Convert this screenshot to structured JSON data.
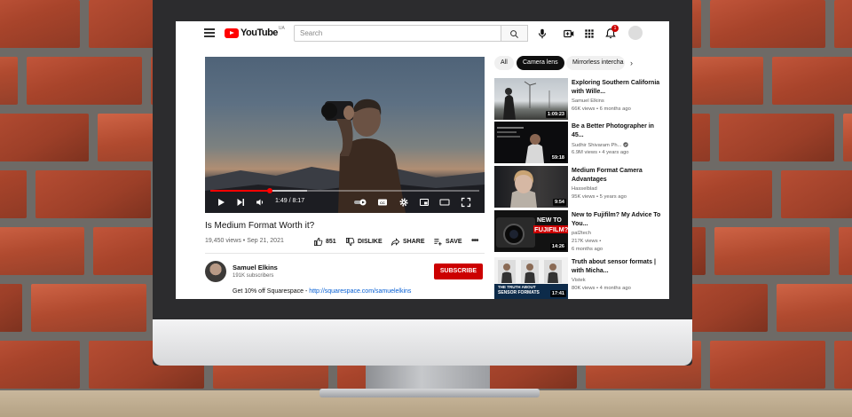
{
  "header": {
    "logo_text": "YouTube",
    "region": "UA",
    "search_placeholder": "Search",
    "notification_count": "1"
  },
  "player": {
    "current_time": "1:49",
    "duration": "8:17",
    "progress_fraction": 0.22,
    "buffered_fraction": 0.36
  },
  "video": {
    "title": "Is Medium Format Worth it?",
    "views": "19,450 views",
    "date": "Sep 21, 2021",
    "meta_sep": " • ",
    "likes": "851",
    "dislike_label": "DISLIKE",
    "share_label": "SHARE",
    "save_label": "SAVE",
    "more": "•••"
  },
  "channel": {
    "name": "Samuel Elkins",
    "subscribers": "191K subscribers",
    "subscribe_label": "SUBSCRIBE"
  },
  "description": {
    "text": "Get 10% off Squarespace - ",
    "link": "http://squarespace.com/samuelelkins"
  },
  "chips": [
    "All",
    "Camera lens",
    "Mirrorless intercha"
  ],
  "chip_next": "›",
  "recommendations": [
    {
      "title": "Exploring Southern California with Wille...",
      "channel": "Samuel Elkins",
      "verified": false,
      "stats": "66K views • 6 months ago",
      "duration": "1:09:23"
    },
    {
      "title": "Be a Better Photographer in 45...",
      "channel": "Sudhir Shivaram Ph...",
      "verified": true,
      "stats": "6.9M views • 4 years ago",
      "duration": "59:18"
    },
    {
      "title": "Medium Format Camera Advantages",
      "channel": "Hasselblad",
      "verified": false,
      "stats": "95K views • 5 years ago",
      "duration": "9:54"
    },
    {
      "title": "New to Fujifilm? My Advice To You...",
      "channel": "pal2tech",
      "verified": false,
      "stats": "217K views •",
      "stats2": "6 months ago",
      "duration": "14:26",
      "thumb_text1": "NEW TO",
      "thumb_text2": "FUJIFILM?"
    },
    {
      "title": "Truth about sensor formats | with Micha...",
      "channel": "Vistek",
      "verified": false,
      "stats": "80K views • 4 months ago",
      "duration": "17:41",
      "thumb_text1": "THE TRUTH ABOUT",
      "thumb_text2": "SENSOR FORMATS"
    }
  ],
  "colors": {
    "youtube_red": "#ff0000",
    "subscribe_red": "#cc0000",
    "link_blue": "#065fd4"
  }
}
